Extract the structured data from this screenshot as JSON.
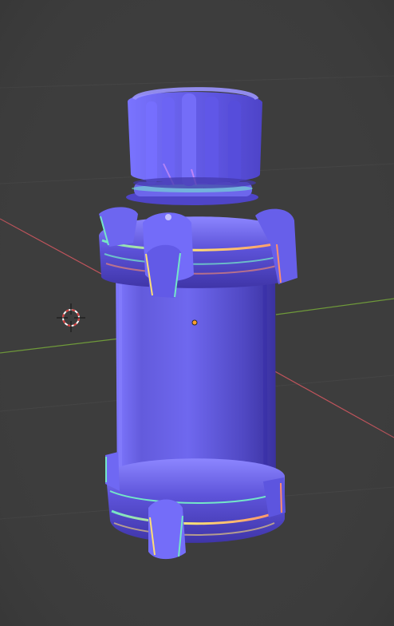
{
  "viewport": {
    "background_color": "#3d3d3d",
    "grid_color": "#444444",
    "x_axis_color": "#c0545c",
    "y_axis_color": "#6f9a3a"
  },
  "scene_object": {
    "type": "canister",
    "shading": "normal-map",
    "base_color": "#6660dd",
    "highlight_color": "#8d86ff",
    "shadow_color": "#3c33a5",
    "rim_colors": [
      "#74e6c8",
      "#ff8f6a",
      "#ffde74"
    ]
  },
  "overlay": {
    "cursor_3d_icon": "3d-cursor-icon",
    "object_origin_icon": "object-origin-icon",
    "origin_color": "#ff9f2c"
  }
}
